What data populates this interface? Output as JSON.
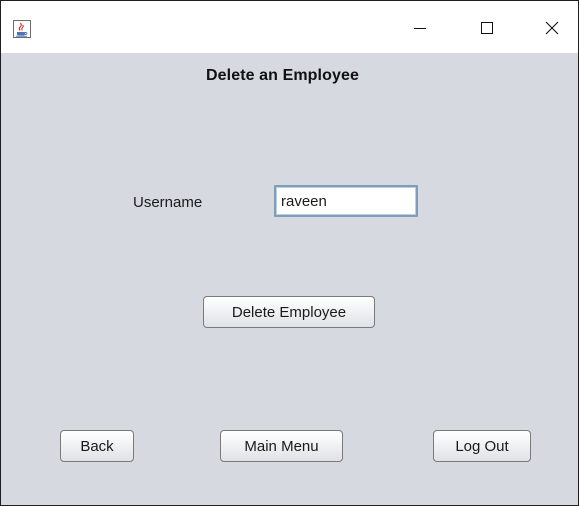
{
  "window": {
    "icon": "java-cup-icon",
    "controls": {
      "minimize_icon": "minimize-icon",
      "maximize_icon": "maximize-icon",
      "close_icon": "close-icon"
    }
  },
  "form": {
    "title": "Delete an Employee",
    "username_label": "Username",
    "username_value": "raveen",
    "delete_button": "Delete Employee"
  },
  "footer": {
    "back_button": "Back",
    "main_menu_button": "Main Menu",
    "logout_button": "Log Out"
  },
  "colors": {
    "content_background": "#d6d9df",
    "input_border": "#7f9db9"
  }
}
